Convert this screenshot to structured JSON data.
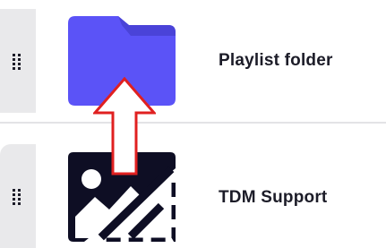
{
  "rows": [
    {
      "label": "Playlist folder",
      "icon": "folder-icon",
      "folder_color": "#5b53f7",
      "folder_tab_color": "#4a43d8"
    },
    {
      "label": "TDM Support",
      "icon": "broken-image-icon",
      "icon_color": "#0e0e24"
    }
  ],
  "annotation": {
    "type": "arrow-up",
    "stroke_color": "#e02020",
    "fill_color": "#ffffff"
  },
  "colors": {
    "handle_bg": "#e9e9eb",
    "divider": "#e3e3e6",
    "text": "#1c1c28"
  }
}
